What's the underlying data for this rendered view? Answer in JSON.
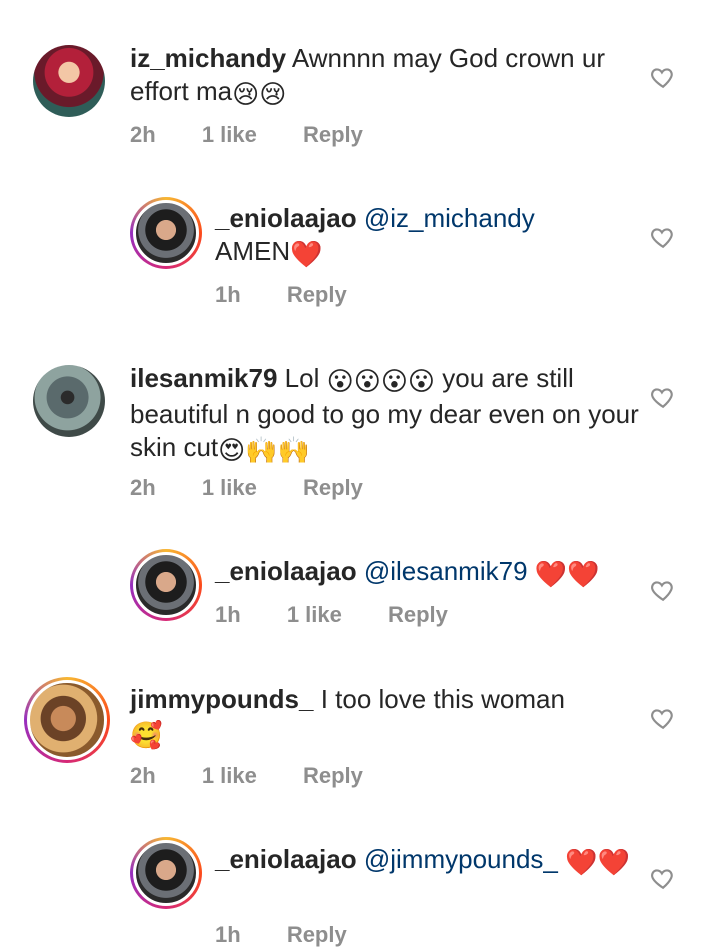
{
  "comments": [
    {
      "username": "iz_michandy",
      "text": "Awnnnn may God crown ur effort ma",
      "emoji_after": "😢😢",
      "time": "2h",
      "likes": "1 like",
      "reply": "Reply"
    },
    {
      "username": "_eniolaajao",
      "mention": "@iz_michandy",
      "text": "AMEN",
      "emoji_after": "❤️",
      "time": "1h",
      "reply": "Reply"
    },
    {
      "username": "ilesanmik79",
      "text_before": "Lol",
      "emoji_mid": "😮😮😮😮",
      "text": "you are still beautiful n good to go my dear even on your skin cut",
      "emoji_after": "😍🙌🙌",
      "time": "2h",
      "likes": "1 like",
      "reply": "Reply"
    },
    {
      "username": "_eniolaajao",
      "mention": "@ilesanmik79",
      "emoji_after": "❤️❤️",
      "time": "1h",
      "likes": "1 like",
      "reply": "Reply"
    },
    {
      "username": "jimmypounds_",
      "text": "I too love this woman",
      "emoji_after": "🥰",
      "time": "2h",
      "likes": "1 like",
      "reply": "Reply"
    },
    {
      "username": "_eniolaajao",
      "mention": "@jimmypounds_",
      "emoji_after": "❤️❤️",
      "time": "1h",
      "reply": "Reply"
    }
  ]
}
